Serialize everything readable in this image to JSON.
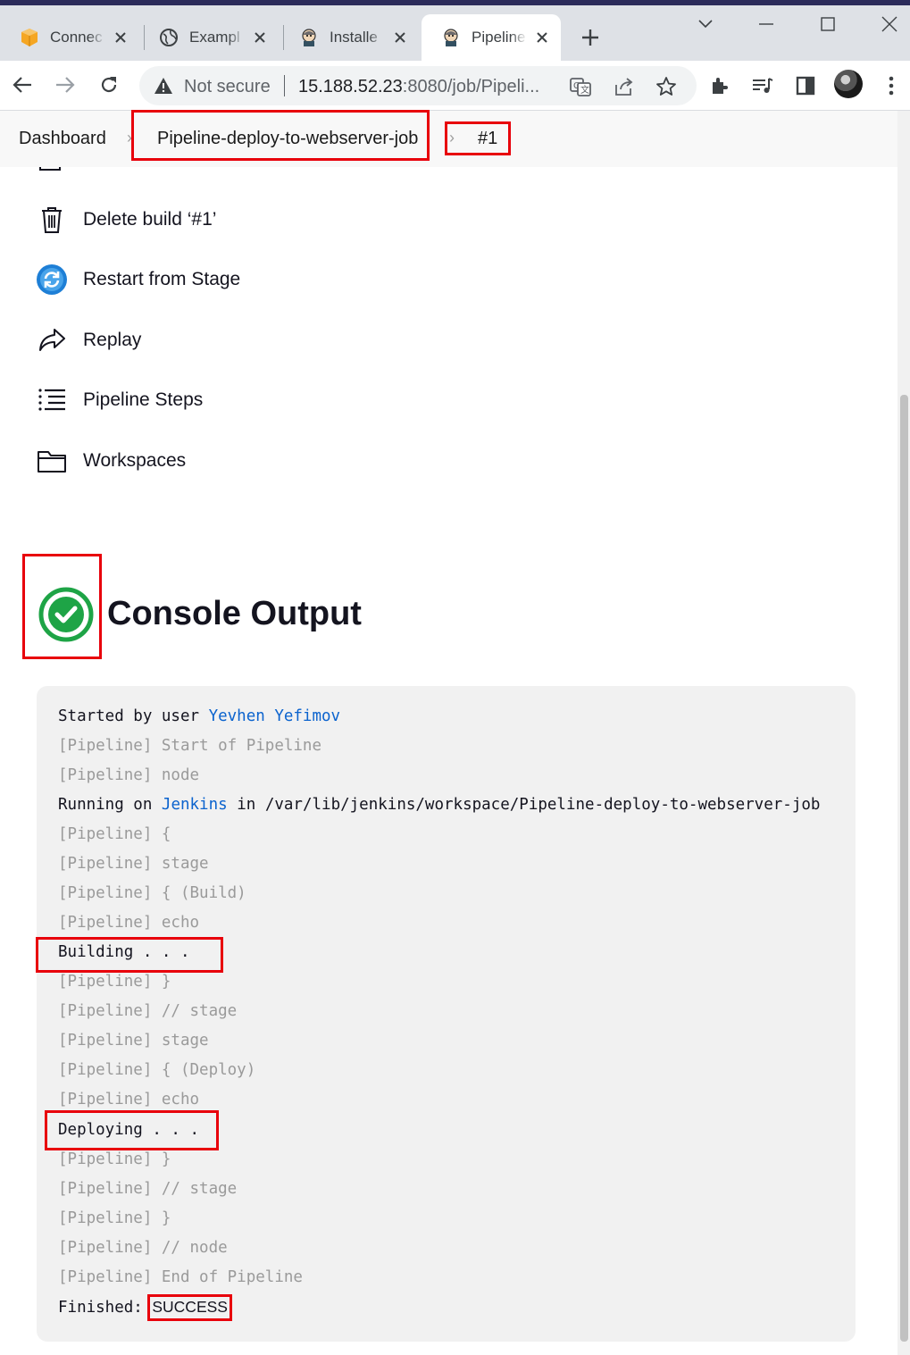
{
  "browser": {
    "tabs": [
      {
        "title": "Connec",
        "icon": "aws-box-icon"
      },
      {
        "title": "Exampl",
        "icon": "globe-icon"
      },
      {
        "title": "Installe",
        "icon": "jenkins-icon"
      },
      {
        "title": "Pipeline",
        "icon": "jenkins-icon",
        "active": true
      }
    ],
    "address": {
      "security": "Not secure",
      "host": "15.188.52.23",
      "path": ":8080/job/Pipeli..."
    }
  },
  "breadcrumb": {
    "items": [
      "Dashboard",
      "Pipeline-deploy-to-webserver-job",
      "#1"
    ]
  },
  "sidebar": {
    "items": [
      {
        "label": "Delete build ‘#1’",
        "icon": "trash-icon"
      },
      {
        "label": "Restart from Stage",
        "icon": "restart-icon"
      },
      {
        "label": "Replay",
        "icon": "replay-icon"
      },
      {
        "label": "Pipeline Steps",
        "icon": "list-steps-icon"
      },
      {
        "label": "Workspaces",
        "icon": "folder-icon"
      }
    ]
  },
  "main": {
    "title": "Console Output",
    "status": "success",
    "status_color": "#1ea446"
  },
  "console": {
    "started_prefix": "Started by user ",
    "user": "Yevhen Yefimov",
    "running_prefix": "Running on ",
    "node": "Jenkins",
    "running_suffix": " in /var/lib/jenkins/workspace/Pipeline-deploy-to-webserver-job",
    "lines": [
      "[Pipeline] Start of Pipeline",
      "[Pipeline] node",
      "[Pipeline] {",
      "[Pipeline] stage",
      "[Pipeline] { (Build)",
      "[Pipeline] echo",
      "Building . . .",
      "[Pipeline] }",
      "[Pipeline] // stage",
      "[Pipeline] stage",
      "[Pipeline] { (Deploy)",
      "[Pipeline] echo",
      "Deploying . . .",
      "[Pipeline] }",
      "[Pipeline] // stage",
      "[Pipeline] }",
      "[Pipeline] // node",
      "[Pipeline] End of Pipeline"
    ],
    "finished_prefix": "Finished: ",
    "result": "SUCCESS"
  },
  "colors": {
    "highlight": "#e8000b",
    "link": "#0b63ce"
  }
}
